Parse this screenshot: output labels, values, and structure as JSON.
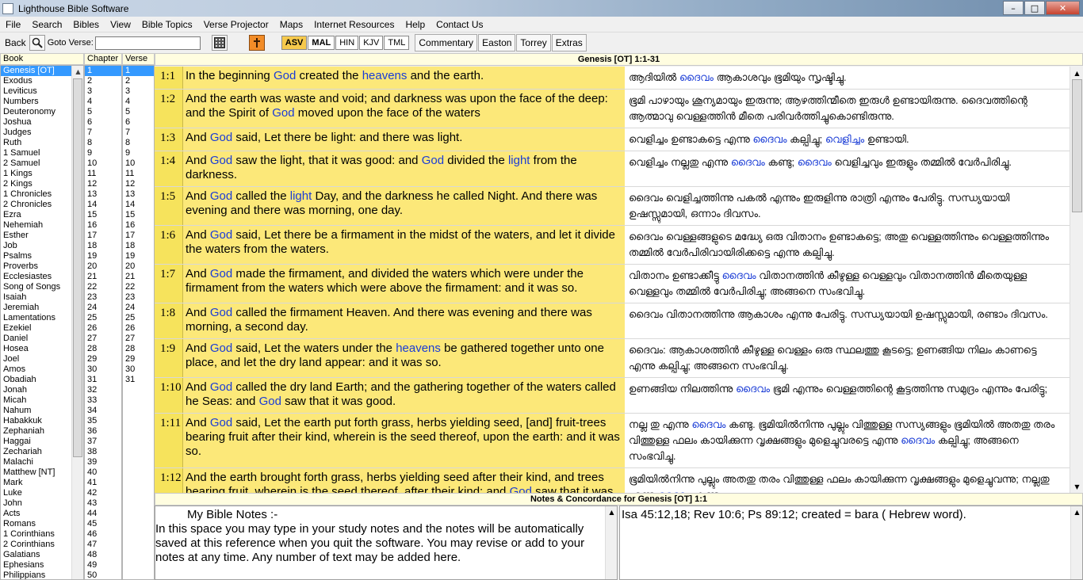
{
  "window": {
    "title": "Lighthouse Bible Software",
    "controls": {
      "minimize": "–",
      "maximize": "□",
      "close": "✕"
    }
  },
  "menu": [
    "File",
    "Search",
    "Bibles",
    "View",
    "Bible Topics",
    "Verse Projector",
    "Maps",
    "Internet Resources",
    "Help",
    "Contact Us"
  ],
  "toolbar": {
    "back_label": "Back",
    "goto_label": "Goto Verse:",
    "goto_value": "",
    "versions": [
      "ASV",
      "MAL",
      "HIN",
      "KJV",
      "TML"
    ],
    "active_version": "ASV",
    "references": [
      "Commentary",
      "Easton",
      "Torrey",
      "Extras"
    ]
  },
  "panels": {
    "book_header": "Book",
    "chapter_header": "Chapter",
    "verse_header": "Verse",
    "books": [
      "Genesis [OT]",
      "Exodus",
      "Leviticus",
      "Numbers",
      "Deuteronomy",
      "Joshua",
      "Judges",
      "Ruth",
      "1 Samuel",
      "2 Samuel",
      "1 Kings",
      "2 Kings",
      "1 Chronicles",
      "2 Chronicles",
      "Ezra",
      "Nehemiah",
      "Esther",
      "Job",
      "Psalms",
      "Proverbs",
      "Ecclesiastes",
      "Song of Songs",
      "Isaiah",
      "Jeremiah",
      "Lamentations",
      "Ezekiel",
      "Daniel",
      "Hosea",
      "Joel",
      "Amos",
      "Obadiah",
      "Jonah",
      "Micah",
      "Nahum",
      "Habakkuk",
      "Zephaniah",
      "Haggai",
      "Zechariah",
      "Malachi",
      "Matthew [NT]",
      "Mark",
      "Luke",
      "John",
      "Acts",
      "Romans",
      "1 Corinthians",
      "2 Corinthians",
      "Galatians",
      "Ephesians",
      "Philippians"
    ],
    "chapters": [
      "1",
      "2",
      "3",
      "4",
      "5",
      "6",
      "7",
      "8",
      "9",
      "10",
      "11",
      "12",
      "13",
      "14",
      "15",
      "16",
      "17",
      "18",
      "19",
      "20",
      "21",
      "22",
      "23",
      "24",
      "25",
      "26",
      "27",
      "28",
      "29",
      "30",
      "31",
      "32",
      "33",
      "34",
      "35",
      "36",
      "37",
      "38",
      "39",
      "40",
      "41",
      "42",
      "43",
      "44",
      "45",
      "46",
      "47",
      "48",
      "49",
      "50"
    ],
    "verses": [
      "1",
      "2",
      "3",
      "4",
      "5",
      "6",
      "7",
      "8",
      "9",
      "10",
      "11",
      "12",
      "13",
      "14",
      "15",
      "16",
      "17",
      "18",
      "19",
      "20",
      "21",
      "22",
      "23",
      "24",
      "25",
      "26",
      "27",
      "28",
      "29",
      "30",
      "31"
    ],
    "selected_book": "Genesis [OT]",
    "selected_chapter": "1",
    "selected_verse": "1"
  },
  "main": {
    "header": "Genesis [OT] 1:1-31",
    "verses": [
      {
        "ref": "1:1",
        "en": [
          [
            "In the beginning ",
            0
          ],
          [
            "God",
            1
          ],
          [
            " created the ",
            0
          ],
          [
            "heavens",
            1
          ],
          [
            " and the earth.",
            0
          ]
        ],
        "ml": [
          [
            "ആദിയിൽ ",
            0
          ],
          [
            "ദൈവം",
            1
          ],
          [
            " ആകാശവും ഭൂമിയും സൃഷ്ടിച്ചു.",
            0
          ]
        ]
      },
      {
        "ref": "1:2",
        "en": [
          [
            "And the earth was waste and void; and darkness was upon the face of the deep: and the Spirit of ",
            0
          ],
          [
            "God",
            1
          ],
          [
            " moved upon the face of the waters",
            0
          ]
        ],
        "ml": [
          [
            "ഭൂമി പാഴായും ശൂന്യമായും ഇരുന്നു; ആഴത്തിന്മീതെ ഇരുൾ ഉണ്ടായിരുന്നു. ദൈവത്തിന്റെ ആത്മാവു വെള്ളത്തിൻ മീതെ പരിവർത്തിച്ചുകൊണ്ടിരുന്നു.",
            0
          ]
        ]
      },
      {
        "ref": "1:3",
        "en": [
          [
            "And ",
            0
          ],
          [
            "God",
            1
          ],
          [
            " said, Let there be light: and there was light.",
            0
          ]
        ],
        "ml": [
          [
            "വെളിച്ചം ഉണ്ടാകട്ടെ എന്നു ",
            0
          ],
          [
            "ദൈവം",
            1
          ],
          [
            " കല്പിച്ചു; ",
            0
          ],
          [
            "വെളിച്ചം",
            1
          ],
          [
            " ഉണ്ടായി.",
            0
          ]
        ]
      },
      {
        "ref": "1:4",
        "en": [
          [
            "And ",
            0
          ],
          [
            "God",
            1
          ],
          [
            " saw the light, that it was good: and ",
            0
          ],
          [
            "God",
            1
          ],
          [
            " divided the ",
            0
          ],
          [
            "light",
            1
          ],
          [
            " from the darkness.",
            0
          ]
        ],
        "ml": [
          [
            "വെളിച്ചം നല്ലതു എന്നു ",
            0
          ],
          [
            "ദൈവം",
            1
          ],
          [
            " കണ്ടു; ",
            0
          ],
          [
            "ദൈവം",
            1
          ],
          [
            " വെളിച്ചവും ഇരുളും തമ്മിൽ വേർപിരിച്ചു.",
            0
          ]
        ]
      },
      {
        "ref": "1:5",
        "en": [
          [
            "And ",
            0
          ],
          [
            "God",
            1
          ],
          [
            " called the ",
            0
          ],
          [
            "light",
            1
          ],
          [
            " Day, and the darkness he called Night. And there was evening and there was morning, one day.",
            0
          ]
        ],
        "ml": [
          [
            "ദൈവം വെളിച്ചത്തിന്നു പകൽ എന്നും ഇരുളിന്നു രാത്രി എന്നും പേരിട്ടു. സന്ധ്യയായി ഉഷസ്സുമായി, ഒന്നാം ദിവസം.",
            0
          ]
        ]
      },
      {
        "ref": "1:6",
        "en": [
          [
            "And ",
            0
          ],
          [
            "God",
            1
          ],
          [
            " said, Let there be a firmament in the midst of the waters, and let it divide the waters from the waters.",
            0
          ]
        ],
        "ml": [
          [
            "ദൈവം വെള്ളങ്ങളുടെ മദ്ധ്യേ ഒരു വിതാനം ഉണ്ടാകട്ടെ; അതു വെള്ളത്തിന്നും വെള്ളത്തിന്നും തമ്മിൽ വേർപിരിവായിരിക്കട്ടെ എന്നു കല്പിച്ചു.",
            0
          ]
        ]
      },
      {
        "ref": "1:7",
        "en": [
          [
            "And ",
            0
          ],
          [
            "God",
            1
          ],
          [
            " made the firmament, and divided the waters which were under the firmament from the waters which were above the firmament: and it was so.",
            0
          ]
        ],
        "ml": [
          [
            "വിതാനം ഉണ്ടാക്കീട്ടു ",
            0
          ],
          [
            "ദൈവം",
            1
          ],
          [
            " വിതാനത്തിൻ കീഴുള്ള വെള്ളവും വിതാനത്തിൻ മീതെയുള്ള വെള്ളവും തമ്മിൽ വേർപിരിച്ചു; അങ്ങനെ സംഭവിച്ചു.",
            0
          ]
        ]
      },
      {
        "ref": "1:8",
        "en": [
          [
            "And ",
            0
          ],
          [
            "God",
            1
          ],
          [
            " called the firmament Heaven. And there was evening and there was morning, a second day.",
            0
          ]
        ],
        "ml": [
          [
            "ദൈവം വിതാനത്തിന്നു ആകാശം എന്നു പേരിട്ടു. സന്ധ്യയായി ഉഷസ്സുമായി, രണ്ടാം ദിവസം.",
            0
          ]
        ]
      },
      {
        "ref": "1:9",
        "en": [
          [
            "And ",
            0
          ],
          [
            "God",
            1
          ],
          [
            " said, Let the waters under the ",
            0
          ],
          [
            "heavens",
            1
          ],
          [
            " be gathered together unto one place, and let the dry land appear: and it was so.",
            0
          ]
        ],
        "ml": [
          [
            "ദൈവം: ആകാശത്തിൻ കീഴുള്ള വെള്ളം ഒരു സ്ഥലത്തു കൂടട്ടെ; ഉണങ്ങിയ നിലം കാണട്ടെ എന്നു കല്പിച്ചു; അങ്ങനെ സംഭവിച്ചു.",
            0
          ]
        ]
      },
      {
        "ref": "1:10",
        "en": [
          [
            "And ",
            0
          ],
          [
            "God",
            1
          ],
          [
            " called the dry land Earth; and the gathering together of the waters called he Seas: and ",
            0
          ],
          [
            "God",
            1
          ],
          [
            " saw that it was good.",
            0
          ]
        ],
        "ml": [
          [
            "ഉണങ്ങിയ നിലത്തിന്നു ",
            0
          ],
          [
            "ദൈവം",
            1
          ],
          [
            " ഭൂമി എന്നും വെള്ളത്തിന്റെ കൂട്ടത്തിന്നു സമുദ്രം എന്നും പേരിട്ടു;",
            0
          ]
        ]
      },
      {
        "ref": "1:11",
        "en": [
          [
            "And ",
            0
          ],
          [
            "God",
            1
          ],
          [
            " said, Let the earth put forth grass, herbs yielding seed, [and] fruit-trees bearing fruit after their kind, wherein is the seed thereof, upon the earth: and it was so.",
            0
          ]
        ],
        "ml": [
          [
            "നല്ല  തു എന്നു ",
            0
          ],
          [
            "ദൈവം",
            1
          ],
          [
            " കണ്ടു. ഭൂമിയിൽനിന്നു പുല്ലും വിത്തുള്ള സസ്യങ്ങളും ഭൂമിയിൽ അതതു തരം വിത്തുള്ള ഫലം കായിക്കുന്ന വൃക്ഷങ്ങളും മുളെച്ചുവരട്ടെ എന്നു ",
            0
          ],
          [
            "ദൈവം",
            1
          ],
          [
            " കല്പിച്ചു; അങ്ങനെ സംഭവിച്ചു.",
            0
          ]
        ]
      },
      {
        "ref": "1:12",
        "en": [
          [
            "And the earth brought forth grass, herbs yielding seed after their kind, and trees bearing fruit, wherein is the seed thereof, after their kind: and ",
            0
          ],
          [
            "God",
            1
          ],
          [
            " saw that it was good.",
            0
          ]
        ],
        "ml": [
          [
            "ഭൂമിയിൽനിന്നു പുല്ലും അതതു തരം വിത്തുള്ള ഫലം കായിക്കുന്ന വൃക്ഷങ്ങളും മുളെച്ചുവന്നു; നല്ലതു എന്നു ",
            0
          ],
          [
            "ദൈവം",
            1
          ],
          [
            " കണ്ടു.",
            0
          ]
        ]
      }
    ]
  },
  "notes": {
    "header": "Notes & Concordance for Genesis [OT] 1:1",
    "title": "My Bible Notes :-",
    "body": "In this space you may type in your study notes and the notes will be automatically saved at this reference when you quit the software. You may revise or add to your notes at any time. Any number of text may be added here.",
    "concordance": "Isa 45:12,18; Rev 10:6; Ps 89:12; created  = bara ( Hebrew word)."
  },
  "icons": {
    "app": "bible-app-icon",
    "search": "magnifier-icon",
    "keypad": "keypad-icon",
    "bible_book": "bible-cross-icon"
  },
  "colors": {
    "verse_bg": "#fce879",
    "highlight_word": "#1a3cd6",
    "selection": "#3399ff"
  }
}
